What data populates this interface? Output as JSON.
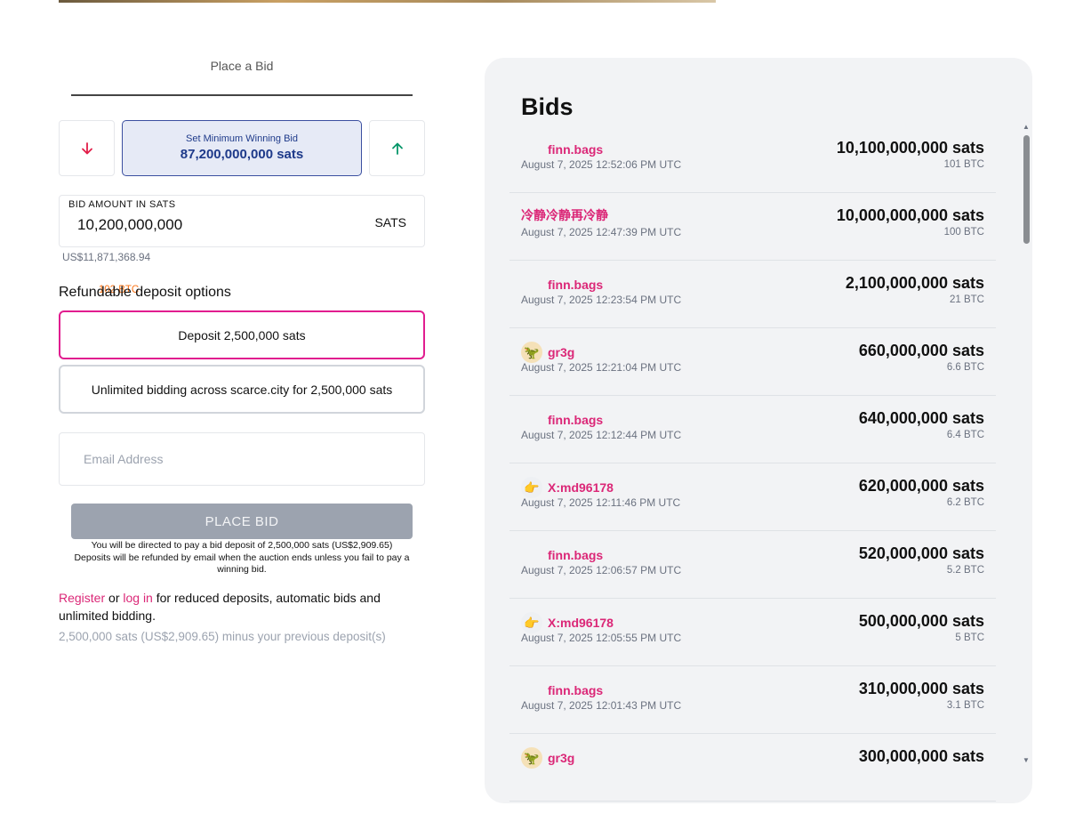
{
  "form": {
    "tab_title": "Place a Bid",
    "min_bid_label": "Set Minimum Winning Bid",
    "min_bid_value": "87,200,000,000 sats",
    "amount_caption": "BID AMOUNT IN SATS",
    "amount_value": "10,200,000,000",
    "amount_unit": "SATS",
    "btc_conversion": "102 BTC",
    "usd_conversion": "US$11,871,368.94",
    "deposit_title": "Refundable deposit options",
    "option_1": "Deposit 2,500,000 sats",
    "option_2": "Unlimited bidding across scarce.city for 2,500,000 sats",
    "email_placeholder": "Email Address",
    "place_bid_label": "PLACE BID",
    "notice_line1": "You will be directed to pay a bid deposit of 2,500,000 sats (US$2,909.65)",
    "notice_line2": "Deposits will be refunded by email when the auction ends unless you fail to pay a",
    "notice_line3": "winning bid.",
    "register_link": "Register",
    "or_text": " or ",
    "login_link": "log in",
    "register_rest": " for reduced deposits, automatic bids and unlimited bidding.",
    "register_sub": "2,500,000 sats (US$2,909.65) minus your previous deposit(s)"
  },
  "bids": {
    "title": "Bids",
    "items": [
      {
        "user": "finn.bags",
        "avatar": "blank",
        "date": "August 7, 2025 12:52:06 PM UTC",
        "amount": "10,100,000,000 sats",
        "btc": "101 BTC"
      },
      {
        "user": "冷静冷静再冷静",
        "avatar": "none",
        "date": "August 7, 2025 12:47:39 PM UTC",
        "amount": "10,000,000,000 sats",
        "btc": "100 BTC"
      },
      {
        "user": "finn.bags",
        "avatar": "blank",
        "date": "August 7, 2025 12:23:54 PM UTC",
        "amount": "2,100,000,000 sats",
        "btc": "21 BTC"
      },
      {
        "user": "gr3g",
        "avatar": "dino",
        "date": "August 7, 2025 12:21:04 PM UTC",
        "amount": "660,000,000 sats",
        "btc": "6.6 BTC"
      },
      {
        "user": "finn.bags",
        "avatar": "blank",
        "date": "August 7, 2025 12:12:44 PM UTC",
        "amount": "640,000,000 sats",
        "btc": "6.4 BTC"
      },
      {
        "user": "X:md96178",
        "avatar": "hand",
        "date": "August 7, 2025 12:11:46 PM UTC",
        "amount": "620,000,000 sats",
        "btc": "6.2 BTC"
      },
      {
        "user": "finn.bags",
        "avatar": "blank",
        "date": "August 7, 2025 12:06:57 PM UTC",
        "amount": "520,000,000 sats",
        "btc": "5.2 BTC"
      },
      {
        "user": "X:md96178",
        "avatar": "hand",
        "date": "August 7, 2025 12:05:55 PM UTC",
        "amount": "500,000,000 sats",
        "btc": "5 BTC"
      },
      {
        "user": "finn.bags",
        "avatar": "blank",
        "date": "August 7, 2025 12:01:43 PM UTC",
        "amount": "310,000,000 sats",
        "btc": "3.1 BTC"
      },
      {
        "user": "gr3g",
        "avatar": "dino",
        "date": "",
        "amount": "300,000,000 sats",
        "btc": ""
      }
    ]
  },
  "colors": {
    "accent_pink": "#db2777",
    "selected_border": "#e11d8f",
    "down_arrow": "#e11d48",
    "up_arrow": "#059669",
    "btc_orange": "#f97316",
    "min_bid_blue": "#1e3a8a"
  },
  "icons": {
    "dino": "🦖",
    "hand": "👉"
  }
}
